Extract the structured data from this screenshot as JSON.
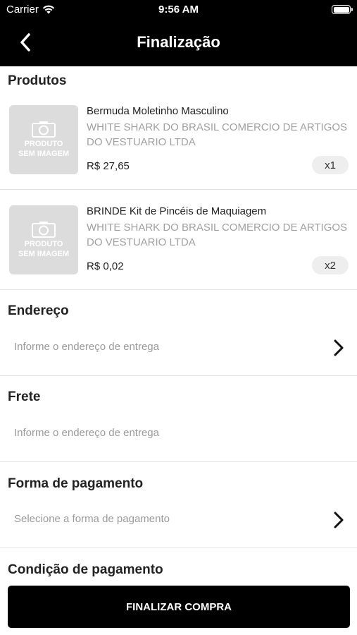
{
  "status": {
    "carrier": "Carrier",
    "time": "9:56 AM"
  },
  "nav": {
    "title": "Finalização"
  },
  "products": {
    "section_title": "Produtos",
    "placeholder_line1": "PRODUTO",
    "placeholder_line2": "SEM IMAGEM",
    "items": [
      {
        "name": "Bermuda Moletinho Masculino",
        "seller": "WHITE SHARK DO BRASIL COMERCIO DE ARTIGOS DO VESTUARIO LTDA",
        "price": "R$ 27,65",
        "qty": "x1"
      },
      {
        "name": "BRINDE Kit de Pincéis de Maquiagem",
        "seller": "WHITE SHARK DO BRASIL COMERCIO DE ARTIGOS DO VESTUARIO LTDA",
        "price": "R$ 0,02",
        "qty": "x2"
      }
    ]
  },
  "address": {
    "title": "Endereço",
    "placeholder": "Informe o endereço de entrega"
  },
  "shipping": {
    "title": "Frete",
    "placeholder": "Informe o endereço de entrega"
  },
  "payment_method": {
    "title": "Forma de pagamento",
    "placeholder": "Selecione a forma de pagamento"
  },
  "payment_condition": {
    "title": "Condição de pagamento"
  },
  "action": {
    "finalize_label": "FINALIZAR COMPRA"
  }
}
